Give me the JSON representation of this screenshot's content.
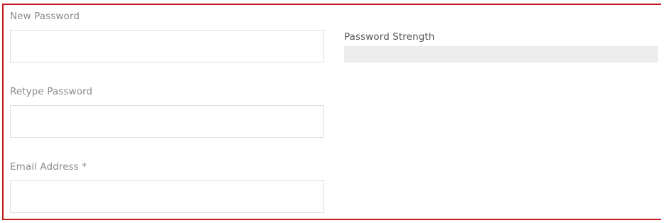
{
  "form": {
    "new_password": {
      "label": "New Password",
      "value": "",
      "placeholder": ""
    },
    "password_strength": {
      "label": "Password Strength",
      "level": 0
    },
    "retype_password": {
      "label": "Retype Password",
      "value": "",
      "placeholder": ""
    },
    "email": {
      "label": "Email Address *",
      "value": "",
      "placeholder": ""
    }
  },
  "colors": {
    "frame_border": "#c4161c",
    "label_text": "#8a8a8a",
    "field_border": "#dedede",
    "strength_track": "#ededed"
  }
}
